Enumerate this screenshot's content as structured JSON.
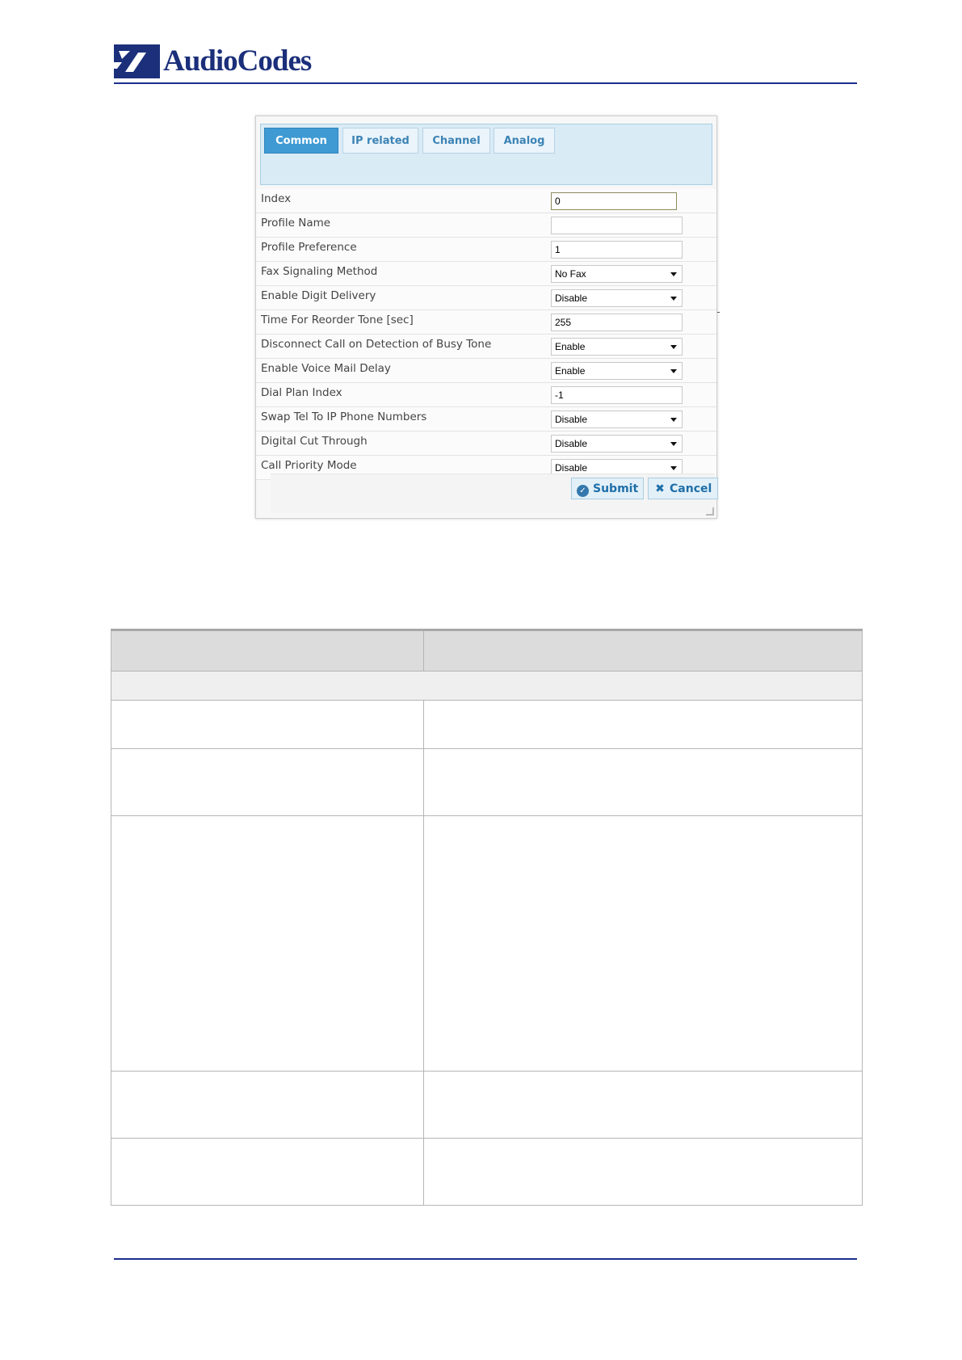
{
  "header": {
    "logo_text": "AudioCodes"
  },
  "form": {
    "tabs": [
      {
        "label": "Common",
        "active": true
      },
      {
        "label": "IP related",
        "active": false
      },
      {
        "label": "Channel",
        "active": false
      },
      {
        "label": "Analog",
        "active": false
      }
    ],
    "fields": [
      {
        "label": "Index",
        "value": "0",
        "type": "text"
      },
      {
        "label": "Profile Name",
        "value": "",
        "type": "text"
      },
      {
        "label": "Profile Preference",
        "value": "1",
        "type": "text"
      },
      {
        "label": "Fax Signaling Method",
        "value": "No Fax",
        "type": "select"
      },
      {
        "label": "Enable Digit Delivery",
        "value": "Disable",
        "type": "select"
      },
      {
        "label": "Time For Reorder Tone [sec]",
        "value": "255",
        "type": "text"
      },
      {
        "label": "Disconnect Call on Detection of Busy Tone",
        "value": "Enable",
        "type": "select"
      },
      {
        "label": "Enable Voice Mail Delay",
        "value": "Enable",
        "type": "select"
      },
      {
        "label": "Dial Plan Index",
        "value": "-1",
        "type": "text"
      },
      {
        "label": "Swap Tel To IP Phone Numbers",
        "value": "Disable",
        "type": "select"
      },
      {
        "label": "Digital Cut Through",
        "value": "Disable",
        "type": "select"
      },
      {
        "label": "Call Priority Mode",
        "value": "Disable",
        "type": "select"
      }
    ],
    "submit_label": "Submit",
    "cancel_label": "Cancel"
  },
  "colors": {
    "brand": "#1b2f7a",
    "tab_active": "#3f9ad3",
    "tab_bar": "#d9ebf5"
  }
}
